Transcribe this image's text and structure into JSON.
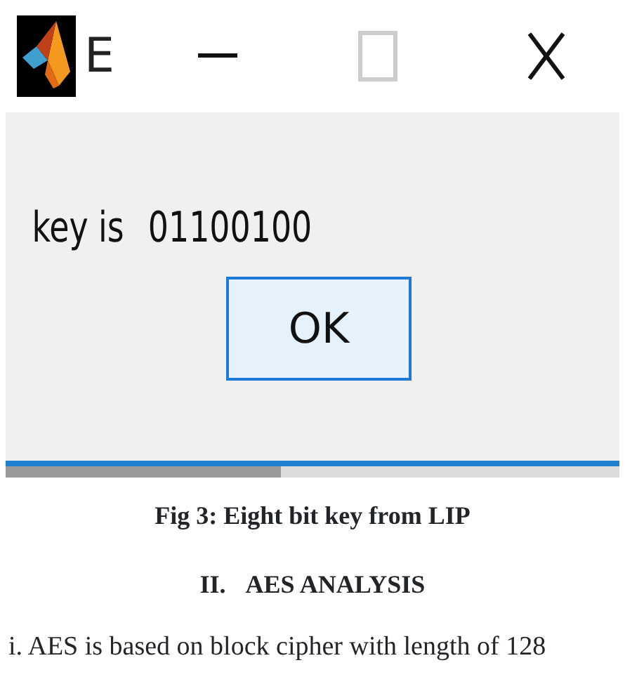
{
  "window": {
    "title": "E"
  },
  "dialog": {
    "message": "key is",
    "value": "01100100",
    "buttons": [
      "OK"
    ]
  },
  "caption": "Fig 3: Eight bit key from LIP",
  "section_heading": {
    "number": "II.",
    "title": "AES ANALYSIS"
  },
  "paragraph": "i. AES is based on block cipher with length of 128"
}
